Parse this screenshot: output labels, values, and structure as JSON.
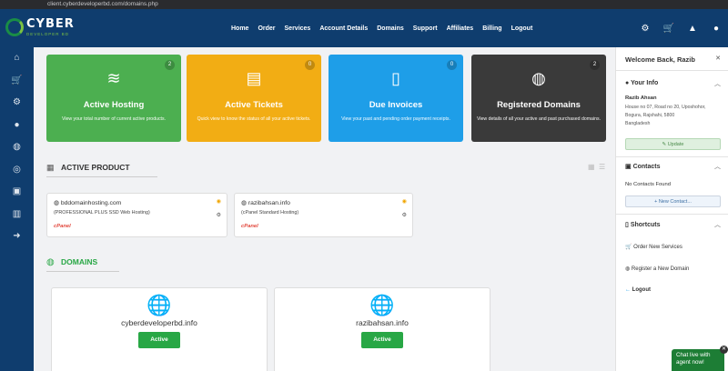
{
  "browser": {
    "url": "client.cyberdeveloperbd.com/domains.php"
  },
  "brand": {
    "name": "CYBER",
    "tagline": "DEVELOPER BD"
  },
  "nav": [
    "Home",
    "Order",
    "Services",
    "Account Details",
    "Domains",
    "Support",
    "Affiliates",
    "Billing",
    "Logout"
  ],
  "tiles": [
    {
      "title": "Active Hosting",
      "desc": "View your total number of current active products.",
      "count": "2",
      "color": "#4caf50"
    },
    {
      "title": "Active Tickets",
      "desc": "Quick view to know the status of all your active tickets.",
      "count": "0",
      "color": "#f2ad14"
    },
    {
      "title": "Due Invoices",
      "desc": "View your past and pending order payment receipts.",
      "count": "0",
      "color": "#1e9ee8"
    },
    {
      "title": "Registered Domains",
      "desc": "View details of all your active and past purchased domains.",
      "count": "2",
      "color": "#3a3a3a"
    }
  ],
  "sections": {
    "active_product": "ACTIVE PRODUCT",
    "domains": "DOMAINS"
  },
  "products": [
    {
      "domain": "bddomainhosting.com",
      "plan": "(PROFESSIONAL PLUS SSD Web Hosting)",
      "brand": "cPanel"
    },
    {
      "domain": "razibahsan.info",
      "plan": "(cPanel Standard Hosting)",
      "brand": "cPanel"
    }
  ],
  "domains": [
    {
      "name": "cyberdeveloperbd.info",
      "status": "Active"
    },
    {
      "name": "razibahsan.info",
      "status": "Active"
    }
  ],
  "right": {
    "welcome": "Welcome Back, Razib",
    "your_info": "Your Info",
    "user_name": "Razib Ahsan",
    "address": [
      "House no 07, Road no 20, Uposhohor,",
      "Bogura, Rajshahi, 5800",
      "Bangladesh"
    ],
    "update": "Update",
    "contacts": "Contacts",
    "no_contacts": "No Contacts Found",
    "new_contact": "+ New Contact...",
    "shortcuts": "Shortcuts",
    "links": [
      "Order New Services",
      "Register a New Domain",
      "Logout"
    ]
  },
  "chat": {
    "line1": "Chat live with",
    "line2": "agent now!"
  }
}
